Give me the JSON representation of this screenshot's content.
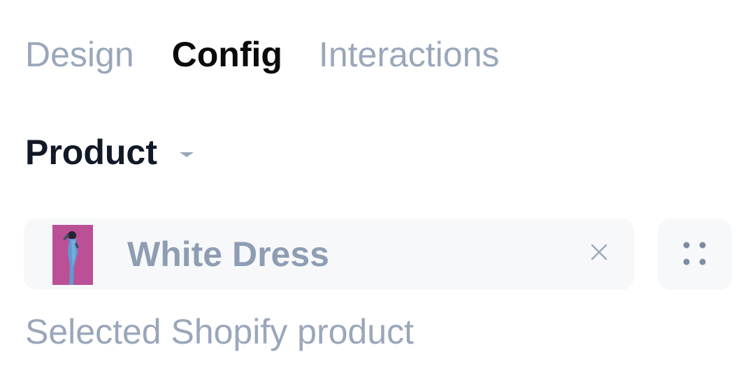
{
  "tabs": [
    {
      "label": "Design",
      "active": false
    },
    {
      "label": "Config",
      "active": true
    },
    {
      "label": "Interactions",
      "active": false
    }
  ],
  "section": {
    "title": "Product",
    "caret_icon": "caret-down-icon"
  },
  "product_field": {
    "value": "White Dress",
    "thumbnail": "product-thumbnail-image",
    "clear_icon": "close-icon"
  },
  "drag_handle": {
    "icon": "drag-handle-icon"
  },
  "helper_text": "Selected Shopify product",
  "colors": {
    "muted_text": "#9aa7ba",
    "active_text": "#0b0b0c",
    "field_bg": "#f7f8fa",
    "thumb_bg": "#c0539a"
  }
}
